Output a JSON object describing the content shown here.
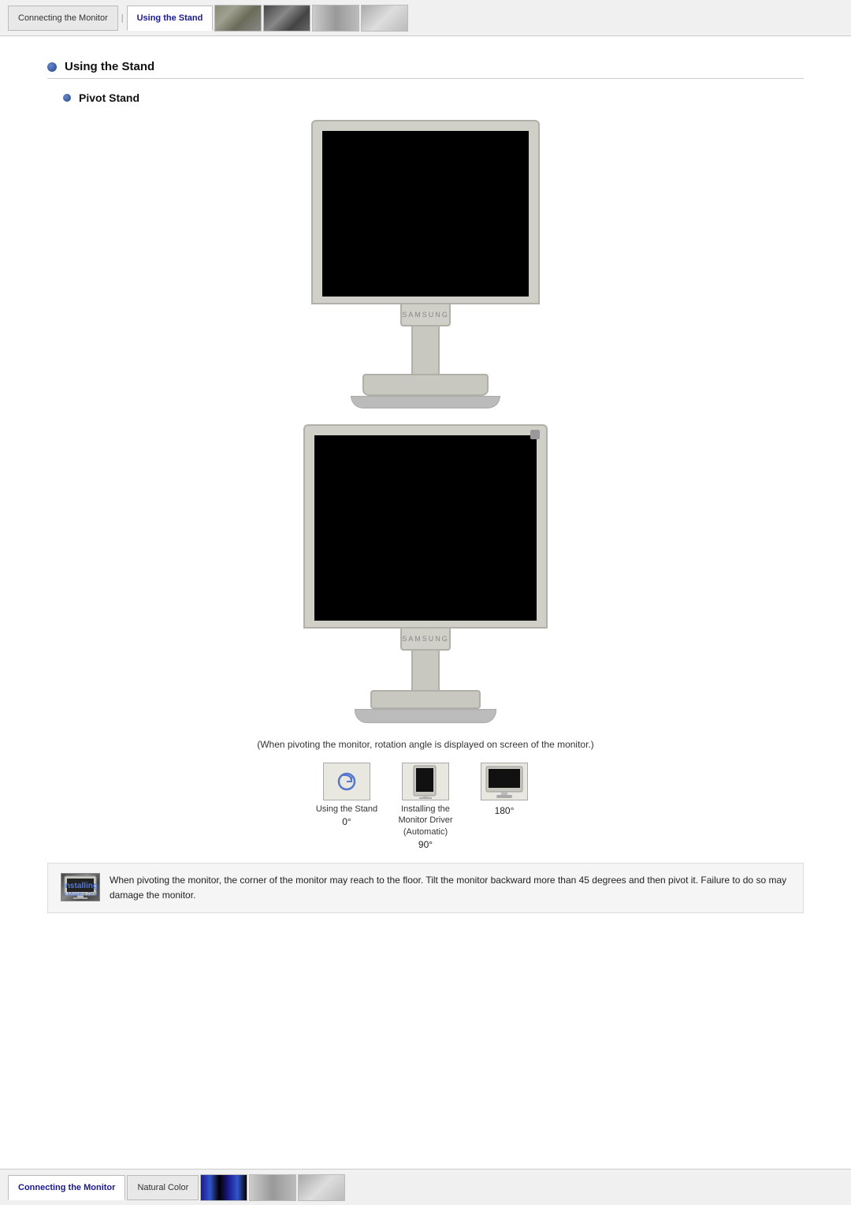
{
  "topNav": {
    "tabs": [
      {
        "label": "Connecting the Monitor",
        "active": false
      },
      {
        "label": "Using the Stand",
        "active": true
      }
    ],
    "thumbnails": [
      "thumb-1",
      "thumb-2",
      "thumb-3",
      "thumb-4"
    ]
  },
  "section": {
    "title": "Using the Stand",
    "subSection": {
      "title": "Pivot Stand"
    }
  },
  "monitors": {
    "brand": "SAMSUNG"
  },
  "pivotCaption": "(When pivoting the monitor, rotation angle is displayed on screen of the monitor.)",
  "rotationDiagram": {
    "items": [
      {
        "angle": "0°",
        "linkText": "Using the Stand"
      },
      {
        "angle": "90°",
        "linkText": "Installing the Monitor Driver\n(Automatic)"
      },
      {
        "angle": "180°",
        "linkText": ""
      }
    ]
  },
  "warning": {
    "text": "When pivoting the monitor, the corner of the monitor may reach to the floor. Tilt the monitor backward more than 45 degrees and then pivot it. Failure to do so may damage the monitor."
  },
  "bottomNav": {
    "tabs": [
      {
        "label": "Connecting the Monitor",
        "active": false
      },
      {
        "label": "Natural Color",
        "active": true
      }
    ]
  }
}
